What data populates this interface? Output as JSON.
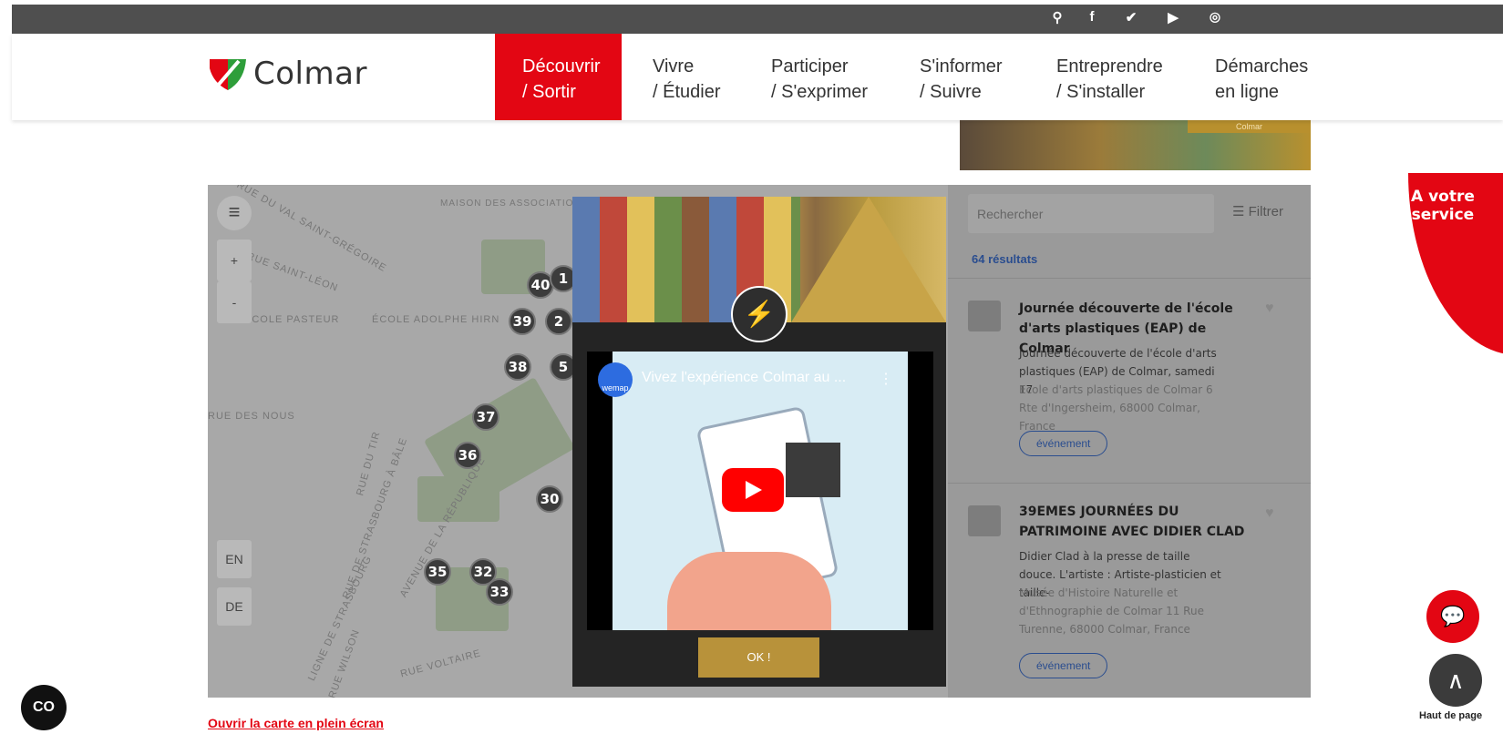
{
  "topbar": {
    "icons": [
      {
        "name": "search-icon",
        "glyph": "⚲"
      },
      {
        "name": "facebook-icon",
        "glyph": "f"
      },
      {
        "name": "twitter-icon",
        "glyph": "✔"
      },
      {
        "name": "youtube-icon",
        "glyph": "▶"
      },
      {
        "name": "instagram-icon",
        "glyph": "◎"
      }
    ]
  },
  "header": {
    "logo_text": "Colmar",
    "nav": [
      {
        "line1": "Découvrir",
        "line2": "/ Sortir",
        "active": true
      },
      {
        "line1": "Vivre",
        "line2": "/ Étudier",
        "active": false
      },
      {
        "line1": "Participer",
        "line2": "/ S'exprimer",
        "active": false
      },
      {
        "line1": "S'informer",
        "line2": "/ Suivre",
        "active": false
      },
      {
        "line1": "Entreprendre",
        "line2": "/ S'installer",
        "active": false
      },
      {
        "line1": "Démarches",
        "line2": "en ligne",
        "active": false
      }
    ]
  },
  "banner": {
    "caption": "Colmar"
  },
  "map": {
    "streets": [
      "RUE DU VAL SAINT-GRÉGOIRE",
      "RUE SAINT-LÉON",
      "ÉCOLE PASTEUR",
      "ÉCOLE ADOLPHE HIRN",
      "MAISON DES ASSOCIATIONS",
      "RUE DU TIR",
      "RUE DE STRASBOURG À BÂLE",
      "AVENUE DE LA RÉPUBLIQUE",
      "LIGNE DE STRASBOURG",
      "RUE VOLTAIRE",
      "RUE DES NOUS",
      "RUE WILSON"
    ],
    "markers": [
      "40",
      "1",
      "39",
      "2",
      "38",
      "5",
      "37",
      "36",
      "30",
      "35",
      "32",
      "33"
    ],
    "lang_en": "EN",
    "lang_de": "DE",
    "menu_icon": "≡",
    "zoom_in": "+",
    "zoom_out": "-"
  },
  "sidebar": {
    "search_placeholder": "Rechercher",
    "filter_label": "Filtrer",
    "results_count": "64 résultats",
    "cards": [
      {
        "title": "Journée découverte de l'école d'arts plastiques (EAP) de Colmar",
        "desc": "Journée découverte de l'école d'arts plastiques (EAP) de Colmar, samedi 17",
        "addr": "Ecole d'arts plastiques de Colmar 6 Rte d'Ingersheim, 68000 Colmar, France",
        "tag": "événement"
      },
      {
        "title": "39EMES JOURNÉES DU PATRIMOINE AVEC DIDIER CLAD",
        "desc": "Didier Clad à la presse de taille douce. L'artiste : Artiste-plasticien et taille-",
        "addr": "Musée d'Histoire Naturelle et d'Ethnographie de Colmar 11 Rue Turenne, 68000 Colmar, France",
        "tag": "événement"
      }
    ]
  },
  "modal": {
    "video_title": "Vivez l'expérience Colmar au ...",
    "channel": "wemap",
    "ok_label": "OK !"
  },
  "service": {
    "line1": "A votre",
    "line2": "service"
  },
  "scroll_top_label": "Haut de page",
  "fullscreen_link": "Ouvrir la carte en plein écran",
  "a11y_label": "CO",
  "colors": {
    "brand_red": "#e30613",
    "gold": "#b8923a",
    "link_blue": "#2a4d8f"
  }
}
